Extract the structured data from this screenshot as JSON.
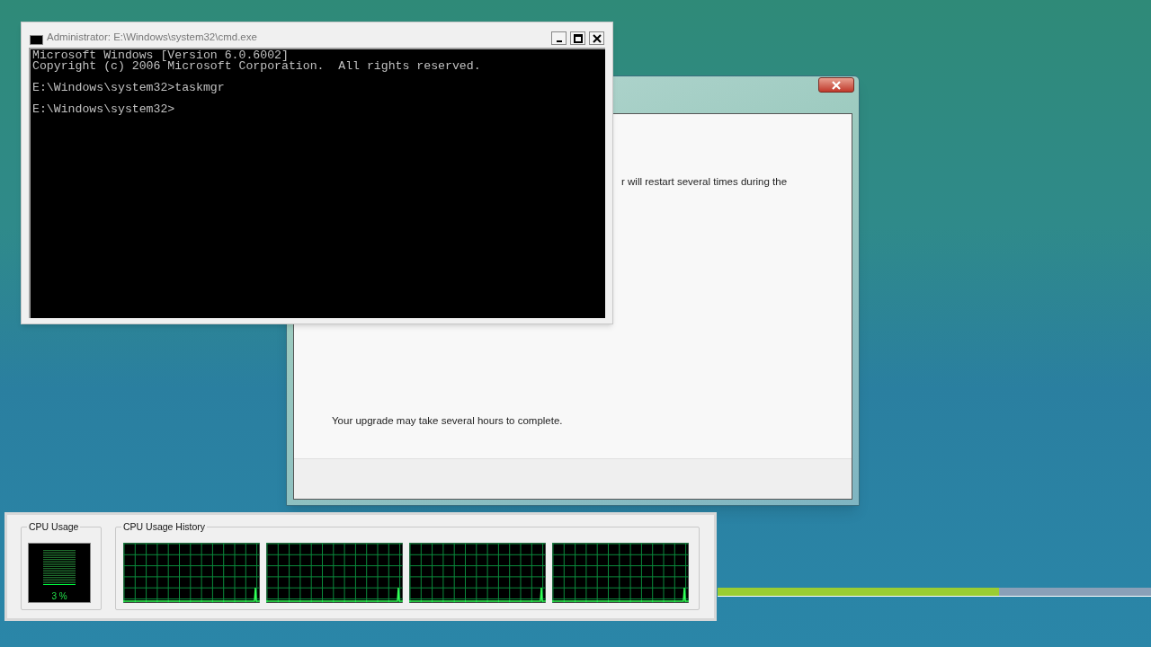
{
  "cmd_window": {
    "title": "Administrator: E:\\Windows\\system32\\cmd.exe",
    "blocks": [
      [
        "Microsoft Windows [Version 6.0.6002]",
        "Copyright (c) 2006 Microsoft Corporation.  All rights reserved."
      ],
      [
        "E:\\Windows\\system32>taskmgr"
      ],
      [
        "E:\\Windows\\system32>"
      ]
    ]
  },
  "setup_window": {
    "message_fragment": "r will restart several times during the",
    "note": "Your upgrade may take several hours to complete."
  },
  "task_manager": {
    "cpu_usage": {
      "title": "CPU Usage",
      "reading": "3 %",
      "level": 0.03
    },
    "cpu_history": {
      "title": "CPU Usage History",
      "graphs": [
        {
          "kind": "graph"
        },
        {
          "kind": "graph"
        },
        {
          "kind": "graph"
        },
        {
          "kind": "graph"
        }
      ]
    }
  },
  "progress": {
    "level": 0.65
  }
}
